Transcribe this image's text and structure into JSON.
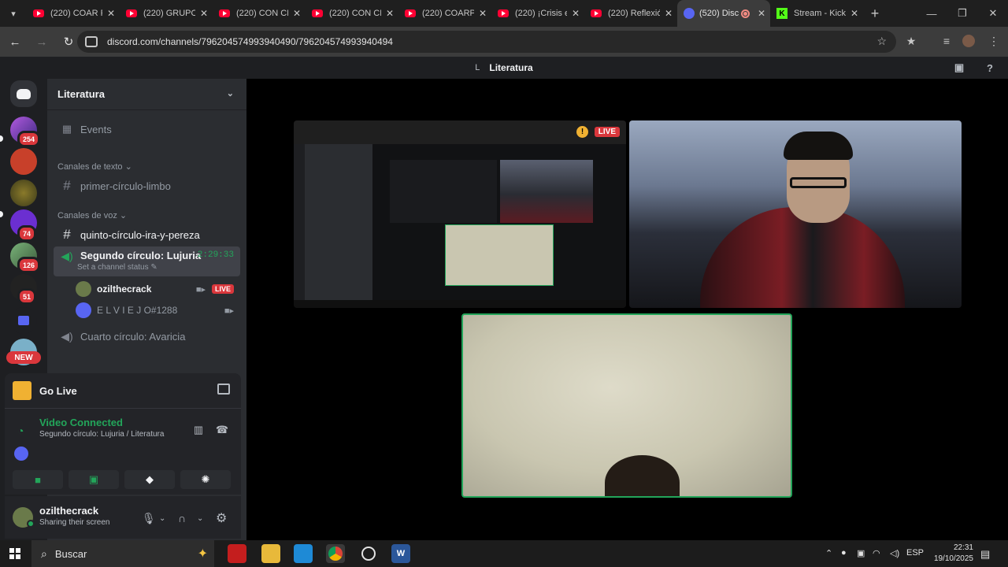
{
  "browser": {
    "tabs": [
      {
        "title": "(220) COAR P",
        "type": "youtube"
      },
      {
        "title": "(220) GRUPO",
        "type": "youtube"
      },
      {
        "title": "(220) CON CI",
        "type": "youtube"
      },
      {
        "title": "(220) CON CI",
        "type": "youtube"
      },
      {
        "title": "(220) COARP",
        "type": "youtube"
      },
      {
        "title": "(220) ¡Crisis e",
        "type": "youtube"
      },
      {
        "title": "(220) Reflexió",
        "type": "youtube"
      },
      {
        "title": "(520) Disc",
        "type": "discord",
        "active": true
      },
      {
        "title": "Stream - Kick",
        "type": "kick"
      }
    ],
    "url": "discord.com/channels/796204574993940490/796204574993940494",
    "tab_close_glyph": "✕",
    "new_tab_glyph": "+"
  },
  "discord": {
    "top_title_letter": "L",
    "top_title": "Literatura",
    "server_badges": [
      "254",
      "74",
      "126",
      "51"
    ],
    "new_label": "NEW",
    "guild_name": "Literatura",
    "events_label": "Events",
    "text_category": "Canales de texto",
    "text_channels": [
      "primer-círculo-limbo"
    ],
    "voice_category": "Canales de voz",
    "voice_channel_text": "quinto-círculo-ira-y-pereza",
    "active_voice": {
      "name": "Segundo círculo: Lujuria",
      "timer": "2:29:33",
      "status": "Set a channel status"
    },
    "voice_users": [
      {
        "name": "ozilthecrack",
        "live": "LIVE"
      },
      {
        "name": "E L V I E J O#1288"
      }
    ],
    "other_voice": "Cuarto círculo: Avaricia",
    "go_live": "Go Live",
    "voice_panel": {
      "title": "Video Connected",
      "subtitle": "Segundo círculo: Lujuria / Literatura"
    },
    "user": {
      "name": "ozilthecrack",
      "status": "Sharing their screen"
    },
    "stage_live_label": "LIVE"
  },
  "taskbar": {
    "search_placeholder": "Buscar",
    "language": "ESP",
    "time": "22:31",
    "date": "19/10/2025"
  },
  "colors": {
    "discord_blurple": "#5865f2",
    "voice_green": "#23a55a",
    "live_red": "#da373c"
  }
}
